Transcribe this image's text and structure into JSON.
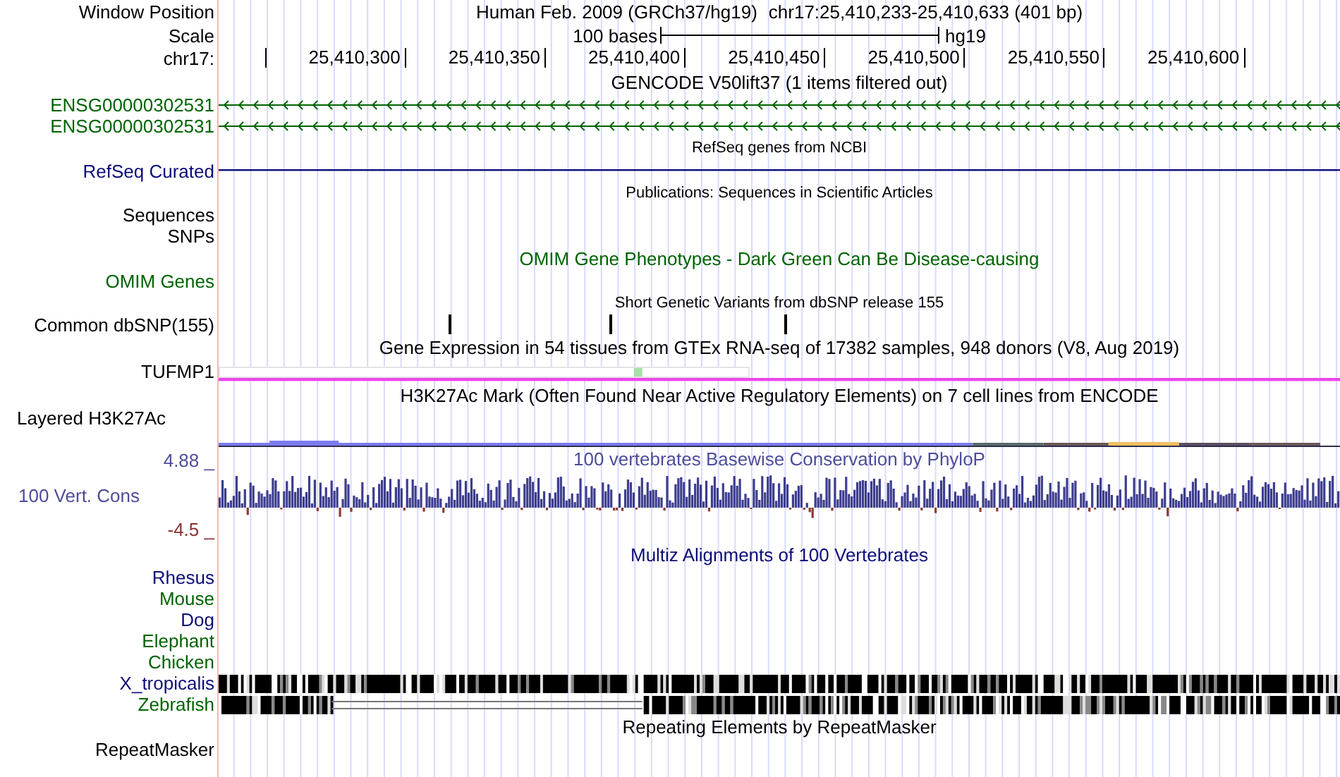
{
  "position": {
    "label": "Window Position",
    "assembly": "Human Feb. 2009 (GRCh37/hg19)",
    "range": "chr17:25,410,233-25,410,633 (401 bp)"
  },
  "scale": {
    "label": "Scale",
    "length": "100 bases",
    "genome": "hg19"
  },
  "ruler": {
    "label": "chr17:",
    "ticks": [
      "25,410,300",
      "25,410,350",
      "25,410,400",
      "25,410,450",
      "25,410,500",
      "25,410,550",
      "25,410,600"
    ]
  },
  "tracks": [
    {
      "kind": "title",
      "text": "GENCODE V50lift37 (1 items filtered out)",
      "color": "#000000"
    },
    {
      "kind": "gene",
      "label": "ENSG00000302531",
      "color": "#006400"
    },
    {
      "kind": "gene",
      "label": "ENSG00000302531",
      "color": "#006400"
    },
    {
      "kind": "small_title",
      "text": "RefSeq genes from NCBI",
      "color": "#000000"
    },
    {
      "kind": "line",
      "label": "RefSeq Curated",
      "color": "#0c0c78"
    },
    {
      "kind": "small_title",
      "text": "Publications: Sequences in Scientific Articles",
      "color": "#000000"
    },
    {
      "kind": "empty",
      "label": "Sequences",
      "color": "#000000"
    },
    {
      "kind": "empty",
      "label": "SNPs",
      "color": "#000000"
    },
    {
      "kind": "title",
      "text": "OMIM Gene Phenotypes - Dark Green Can Be Disease-causing",
      "color": "#006400"
    },
    {
      "kind": "empty",
      "label": "OMIM Genes",
      "color": "#006400"
    },
    {
      "kind": "small_title",
      "text": "Short Genetic Variants from dbSNP release 155",
      "color": "#000000"
    },
    {
      "kind": "snp",
      "label": "Common dbSNP(155)",
      "color": "#000000"
    },
    {
      "kind": "title",
      "text": "Gene Expression in 54 tissues from GTEx RNA-seq of 17382 samples, 948 donors (V8, Aug 2019)",
      "color": "#000000"
    },
    {
      "kind": "expression",
      "label": "TUFMP1",
      "color": "#000000"
    },
    {
      "kind": "title",
      "text": "H3K27Ac Mark (Often Found Near Active Regulatory Elements) on 7 cell lines from ENCODE",
      "color": "#000000"
    },
    {
      "kind": "layered",
      "label": "Layered H3K27Ac",
      "color": "#000000"
    },
    {
      "kind": "conservation",
      "label": "100 Vert. Cons",
      "title": "100 vertebrates Basewise Conservation by PhyloP",
      "max": "4.88 _",
      "min": "-4.5 _",
      "color": "#4d4d9a"
    },
    {
      "kind": "title",
      "text": "Multiz Alignments of 100 Vertebrates",
      "color": "#0c0c78"
    },
    {
      "kind": "empty",
      "label": "Rhesus",
      "color": "#0c0c78"
    },
    {
      "kind": "empty",
      "label": "Mouse",
      "color": "#006400"
    },
    {
      "kind": "empty",
      "label": "Dog",
      "color": "#0c0c78"
    },
    {
      "kind": "empty",
      "label": "Elephant",
      "color": "#006400"
    },
    {
      "kind": "empty",
      "label": "Chicken",
      "color": "#006400"
    },
    {
      "kind": "alignment",
      "label": "X_tropicalis",
      "color": "#0c0c78"
    },
    {
      "kind": "alignment_gapped",
      "label": "Zebrafish",
      "color": "#006400"
    },
    {
      "kind": "title",
      "text": "Repeating Elements by RepeatMasker",
      "color": "#000000"
    },
    {
      "kind": "empty",
      "label": "RepeatMasker",
      "color": "#000000"
    }
  ]
}
